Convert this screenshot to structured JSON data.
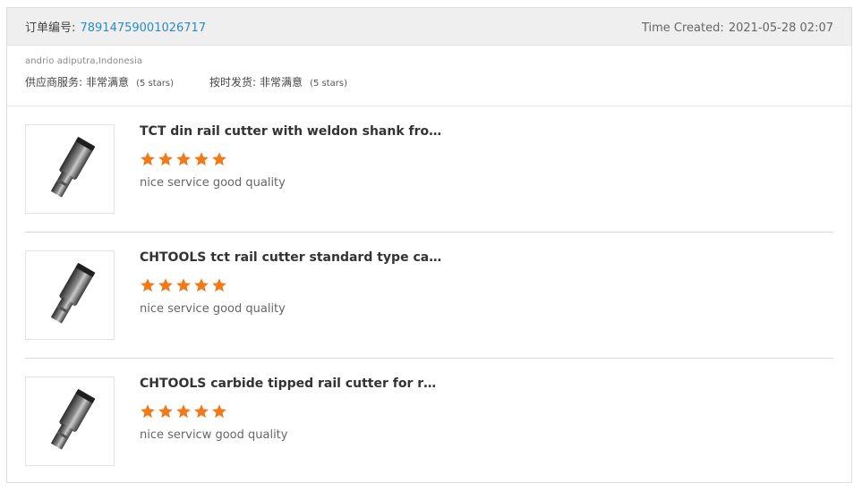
{
  "header": {
    "order_label": "订单编号:",
    "order_number": "78914759001026717",
    "time_label": "Time Created:",
    "time_value": "2021-05-28 02:07"
  },
  "buyer": "andrio adiputra,Indonesia",
  "ratings": {
    "supplier_service_label": "供应商服务:",
    "supplier_service_value": "非常满意",
    "supplier_service_stars": "(5 stars)",
    "on_time_label": "按时发货:",
    "on_time_value": "非常满意",
    "on_time_stars": "(5 stars)"
  },
  "products": [
    {
      "title": "TCT din rail cutter with weldon shank from CHTOOLS",
      "rating": 5,
      "comment": "nice service good quality",
      "image_icon": "rail-cutter-icon"
    },
    {
      "title": "CHTOOLS tct rail cutter standard type carbide tipped",
      "rating": 5,
      "comment": "nice service good quality",
      "image_icon": "rail-cutter-icon"
    },
    {
      "title": "CHTOOLS carbide tipped rail cutter for railway",
      "rating": 5,
      "comment": "nice servicw good quality",
      "image_icon": "rail-cutter-icon"
    }
  ],
  "colors": {
    "star": "#f07a1a",
    "order_number": "#2a8bc5"
  }
}
